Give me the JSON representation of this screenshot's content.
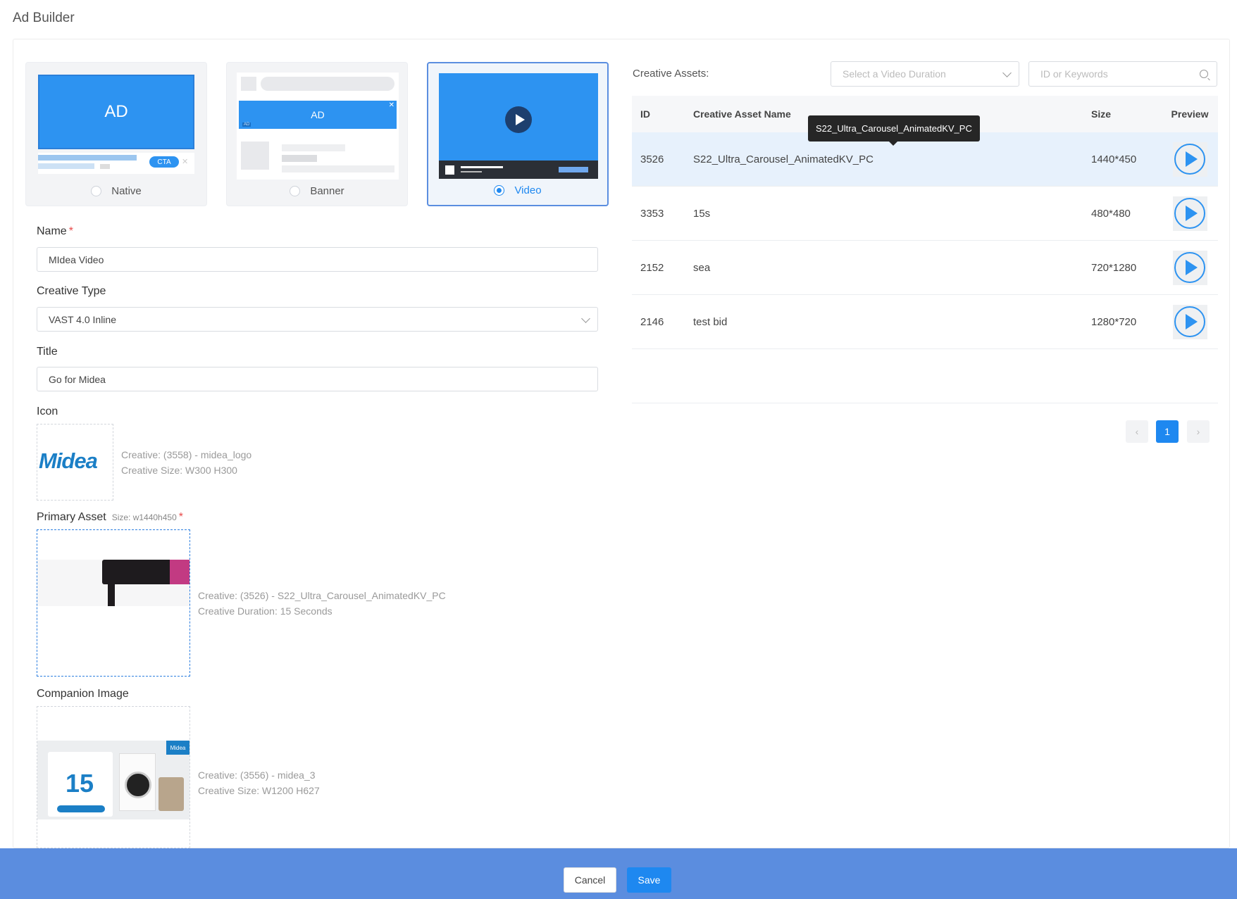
{
  "page_title": "Ad Builder",
  "ad_types": [
    {
      "label": "Native",
      "selected": false,
      "preview_text": "AD",
      "cta": "CTA"
    },
    {
      "label": "Banner",
      "selected": false,
      "preview_text": "AD",
      "tag": "AD"
    },
    {
      "label": "Video",
      "selected": true
    }
  ],
  "form": {
    "name": {
      "label": "Name",
      "required_mark": "*",
      "value": "MIdea Video"
    },
    "creative_type": {
      "label": "Creative Type",
      "value": "VAST 4.0 Inline"
    },
    "title": {
      "label": "Title",
      "value": "Go for Midea"
    },
    "icon": {
      "label": "Icon",
      "logo_text": "Midea",
      "creative": "Creative: (3558) - midea_logo",
      "size": "Creative Size: W300 H300"
    },
    "primary_asset": {
      "label": "Primary Asset",
      "size_hint": "Size: w1440h450",
      "required_mark": "*",
      "creative": "Creative: (3526) - S22_Ultra_Carousel_AnimatedKV_PC",
      "duration": "Creative Duration: 15 Seconds"
    },
    "companion_image": {
      "label": "Companion Image",
      "promo_number": "15",
      "badge": "Midea",
      "creative": "Creative: (3556) - midea_3",
      "size": "Creative Size: W1200 H627"
    }
  },
  "assets": {
    "label": "Creative Assets:",
    "duration_placeholder": "Select a Video Duration",
    "search_placeholder": "ID or Keywords",
    "columns": {
      "id": "ID",
      "name": "Creative Asset Name",
      "size": "Size",
      "preview": "Preview"
    },
    "rows": [
      {
        "id": "3526",
        "name": "S22_Ultra_Carousel_AnimatedKV_PC",
        "size": "1440*450",
        "highlighted": true
      },
      {
        "id": "3353",
        "name": "15s",
        "size": "480*480",
        "highlighted": false
      },
      {
        "id": "2152",
        "name": "sea",
        "size": "720*1280",
        "highlighted": false
      },
      {
        "id": "2146",
        "name": "test bid",
        "size": "1280*720",
        "highlighted": false
      }
    ],
    "tooltip": "S22_Ultra_Carousel_AnimatedKV_PC",
    "current_page": "1"
  },
  "footer": {
    "cancel_label": "Cancel",
    "save_label": "Save"
  },
  "colors": {
    "accent": "#1e88f0",
    "footer": "#5b8ddf",
    "required": "#e84a4a",
    "row_highlight": "#e7f1fc"
  }
}
